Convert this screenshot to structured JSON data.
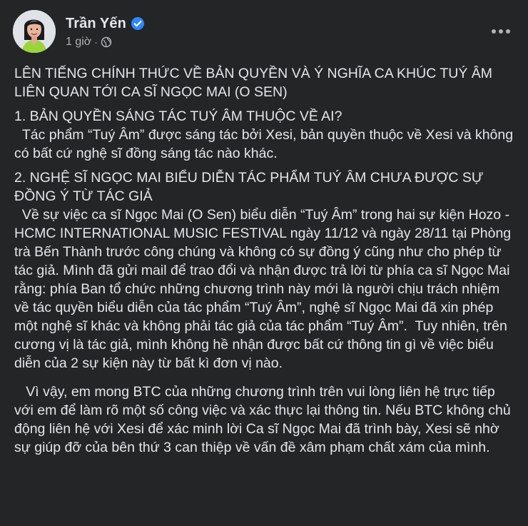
{
  "post": {
    "author": {
      "name": "Trần Yến",
      "verified": true
    },
    "timestamp": "1 giờ",
    "separator": "·",
    "privacy_icon": "globe-icon",
    "more_icon": "more-horizontal-icon",
    "body": {
      "title": "LÊN TIẾNG CHÍNH THỨC VỀ BẢN QUYỀN VÀ Ý NGHĨA CA KHÚC TUÝ ÂM LIÊN QUAN TỚI CA SĨ NGỌC MAI (O SEN)",
      "section1_heading": "1. BẢN QUYỀN SÁNG TÁC TUÝ ÂM THUỘC VỀ AI?",
      "section1_text": "  Tác phẩm “Tuý Âm” được sáng tác bởi Xesi, bản quyền thuộc về Xesi và không có bất cứ nghệ sĩ đồng sáng tác nào khác.",
      "section2_heading": "2. NGHỆ SĨ NGỌC MAI BIỂU DIỄN TÁC PHẨM TUÝ ÂM CHƯA ĐƯỢC SỰ ĐỒNG Ý TỪ TÁC GIẢ",
      "section2_text": "  Về sự việc ca sĩ Ngọc Mai (O Sen) biểu diễn “Tuý Âm” trong hai sự kiện Hozo - HCMC INTERNATIONAL MUSIC FESTIVAL ngày 11/12 và ngày 28/11 tại Phòng trà Bến Thành trước công chúng và không có sự đồng ý cũng như cho phép từ tác giả. Mình đã gửi mail để trao đổi và nhận được trả lời từ phía ca sĩ Ngọc Mai rằng: phía Ban tổ chức những chương trình này mới là người chịu trách nhiệm về tác quyền biểu diễn của tác phẩm “Tuý Âm”, nghệ sĩ Ngọc Mai đã xin phép một nghệ sĩ khác và không phải tác giả của tác phẩm “Tuý Âm”.  Tuy nhiên, trên cương vị là tác giả, mình không hề nhận được bất cứ thông tin gì về việc biểu diễn của 2 sự kiện này từ bất kì đơn vị nào.",
      "closing_text": "   Vì vậy, em mong BTC của những chương trình trên vui lòng liên hệ trực tiếp với em để làm rõ một số công việc và xác thực lại thông tin. Nếu BTC không chủ động liên hệ với Xesi để xác minh lời Ca sĩ Ngọc Mai đã trình bày, Xesi sẽ nhờ sự giúp đỡ của bên thứ 3 can thiệp về vấn đề xâm phạm chất xám của mình."
    },
    "colors": {
      "background": "#242526",
      "text": "#e4e6eb",
      "secondary_text": "#b0b3b8",
      "verified_blue": "#2d88ff"
    }
  }
}
